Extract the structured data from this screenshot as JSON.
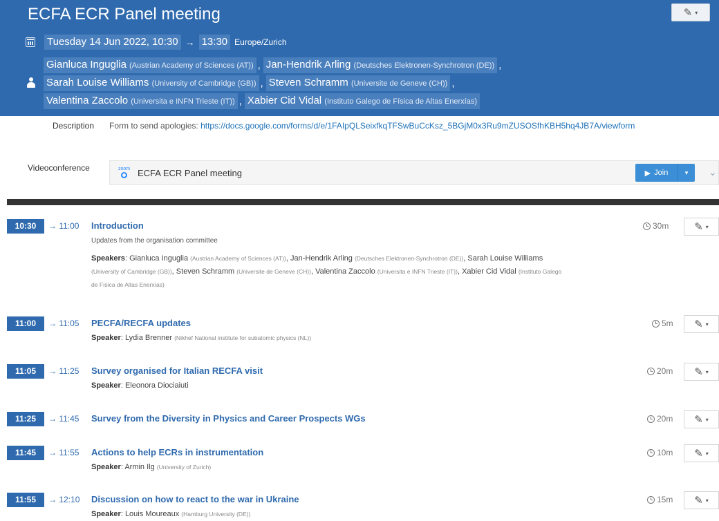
{
  "event": {
    "title": "ECFA ECR Panel meeting",
    "date": "Tuesday 14 Jun 2022, 10:30",
    "arrow": "→",
    "end_time": "13:30",
    "timezone": "Europe/Zurich",
    "chairs": [
      {
        "name": "Gianluca Inguglia",
        "affiliation": "(Austrian Academy of Sciences (AT))"
      },
      {
        "name": "Jan-Hendrik Arling",
        "affiliation": "(Deutsches Elektronen-Synchrotron (DE))"
      },
      {
        "name": "Sarah Louise Williams",
        "affiliation": "(University of Cambridge (GB))"
      },
      {
        "name": "Steven Schramm",
        "affiliation": "(Universite de Geneve (CH))"
      },
      {
        "name": "Valentina Zaccolo",
        "affiliation": "(Universita e INFN Trieste (IT))"
      },
      {
        "name": "Xabier Cid Vidal",
        "affiliation": "(Instituto Galego de Física de Altas Enerxías)"
      }
    ],
    "comma": ","
  },
  "description": {
    "label": "Description",
    "text": "Form to send apologies: ",
    "link": "https://docs.google.com/forms/d/e/1FAIpQLSeixfkqTFSwBuCcKsz_5BGjM0x3Ru9mZUSOSfhKBH5hq4JB7A/viewform"
  },
  "videoconference": {
    "label": "Videoconference",
    "provider_icon_text": "zoom",
    "name": "ECFA ECR Panel meeting",
    "join_label": "Join"
  },
  "timetable": [
    {
      "start": "10:30",
      "end": "→ 11:00",
      "title": "Introduction",
      "duration": "30m",
      "subtitle": "Updates from the organisation committee",
      "speaker_label": "Speakers",
      "speaker_lines": [
        [
          {
            "name": "Gianluca Inguglia",
            "affiliation": "(Austrian Academy of Sciences (AT))"
          },
          {
            "name": "Jan-Hendrik Arling",
            "affiliation": "(Deutsches Elektronen-Synchrotron (DE))"
          },
          {
            "name": "Sarah Louise Williams",
            "affiliation": ""
          }
        ],
        [
          {
            "name": "",
            "affiliation": "(University of Cambridge (GB))"
          },
          {
            "name": "Steven Schramm",
            "affiliation": "(Universite de Geneve (CH))"
          },
          {
            "name": "Valentina Zaccolo",
            "affiliation": "(Universita e INFN Trieste (IT))"
          },
          {
            "name": "Xabier Cid Vidal",
            "affiliation": "(Instituto Galego"
          }
        ],
        [
          {
            "name": "",
            "affiliation": "de Física de Altas Enerxías)"
          }
        ]
      ]
    },
    {
      "start": "11:00",
      "end": "→ 11:05",
      "title": "PECFA/RECFA updates",
      "duration": "5m",
      "speaker_label": "Speaker",
      "speaker": {
        "name": "Lydia Brenner",
        "affiliation": "(Nikhef National institute for subatomic physics (NL))"
      }
    },
    {
      "start": "11:05",
      "end": "→ 11:25",
      "title": "Survey organised for Italian RECFA visit",
      "duration": "20m",
      "speaker_label": "Speaker",
      "speaker": {
        "name": "Eleonora Diociaiuti",
        "affiliation": ""
      }
    },
    {
      "start": "11:25",
      "end": "→ 11:45",
      "title": "Survey from the Diversity in Physics and Career Prospects WGs",
      "duration": "20m"
    },
    {
      "start": "11:45",
      "end": "→ 11:55",
      "title": "Actions to help ECRs in instrumentation",
      "duration": "10m",
      "speaker_label": "Speaker",
      "speaker": {
        "name": "Armin Ilg",
        "affiliation": "(University of Zurich)"
      }
    },
    {
      "start": "11:55",
      "end": "→ 12:10",
      "title": "Discussion on how to react to the war in Ukraine",
      "duration": "15m",
      "speaker_label": "Speaker",
      "speaker": {
        "name": "Louis Moureaux",
        "affiliation": "(Hamburg University (DE))"
      }
    }
  ],
  "colors": {
    "header": "#2f6aae",
    "accent": "#1f72b8",
    "join": "#3c8fd6"
  }
}
